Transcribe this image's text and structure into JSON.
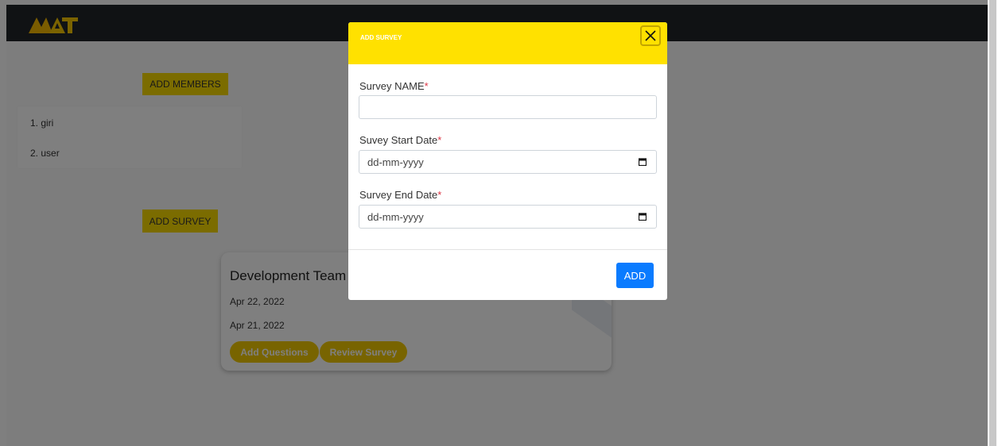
{
  "app": {
    "logo_text": "MAT",
    "add_members_label": "ADD MEMBERS",
    "members": [
      "1. giri",
      "2. user"
    ],
    "add_survey_label": "ADD SURVEY",
    "survey_card": {
      "title": "Development Team Survey",
      "date_1": "Apr 22, 2022",
      "date_2": "Apr 21, 2022",
      "add_questions_label": "Add Questions",
      "review_survey_label": "Review Survey"
    }
  },
  "modal": {
    "title": "ADD SURVEY",
    "name_label": "Survey NAME",
    "name_value": "",
    "start_label": "Suvey Start Date",
    "start_placeholder": "dd-mm-yyyy",
    "end_label": "Survey End Date",
    "end_placeholder": "dd-mm-yyyy",
    "required_mark": "*",
    "add_label": "ADD"
  },
  "colors": {
    "brand_yellow": "#ffe100",
    "primary_blue": "#0a7bff",
    "topbar": "#212529"
  },
  "icons": [
    "logo-icon",
    "close-icon",
    "calendar-icon"
  ]
}
